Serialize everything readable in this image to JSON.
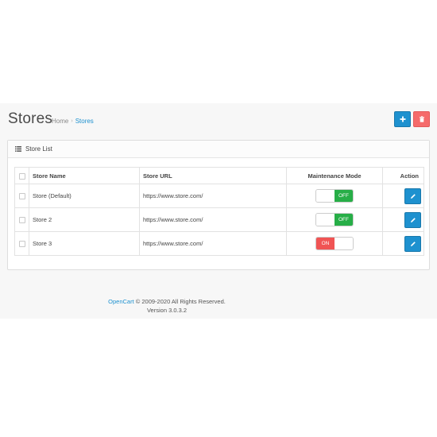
{
  "header": {
    "title": "Stores",
    "breadcrumb": [
      {
        "label": "Home"
      },
      {
        "label": "Stores"
      }
    ],
    "breadcrumb_separator": "›",
    "add_button_icon": "plus-icon",
    "delete_button_icon": "trash-icon"
  },
  "panel": {
    "icon": "list-icon",
    "title": "Store List"
  },
  "table": {
    "columns": [
      "",
      "Store Name",
      "Store URL",
      "Maintenance Mode",
      "Action"
    ],
    "rows": [
      {
        "name_prefix": "Store ",
        "name_suffix": "(Default)",
        "url": "https://www.store.com/",
        "maintenance": "OFF",
        "maintenance_on": false
      },
      {
        "name_prefix": "Store 2",
        "name_suffix": "",
        "url": "https://www.store.com/",
        "maintenance": "OFF",
        "maintenance_on": false
      },
      {
        "name_prefix": "Store 3",
        "name_suffix": "",
        "url": "https://www.store.com/",
        "maintenance": "ON",
        "maintenance_on": true
      }
    ]
  },
  "footer": {
    "brand": "OpenCart",
    "copyright": "© 2009-2020 All Rights Reserved.",
    "version": "Version 3.0.3.2"
  },
  "colors": {
    "primary": "#1e91cf",
    "danger": "#f56b6b",
    "toggle_off": "#27ae47",
    "toggle_on": "#f05454"
  }
}
